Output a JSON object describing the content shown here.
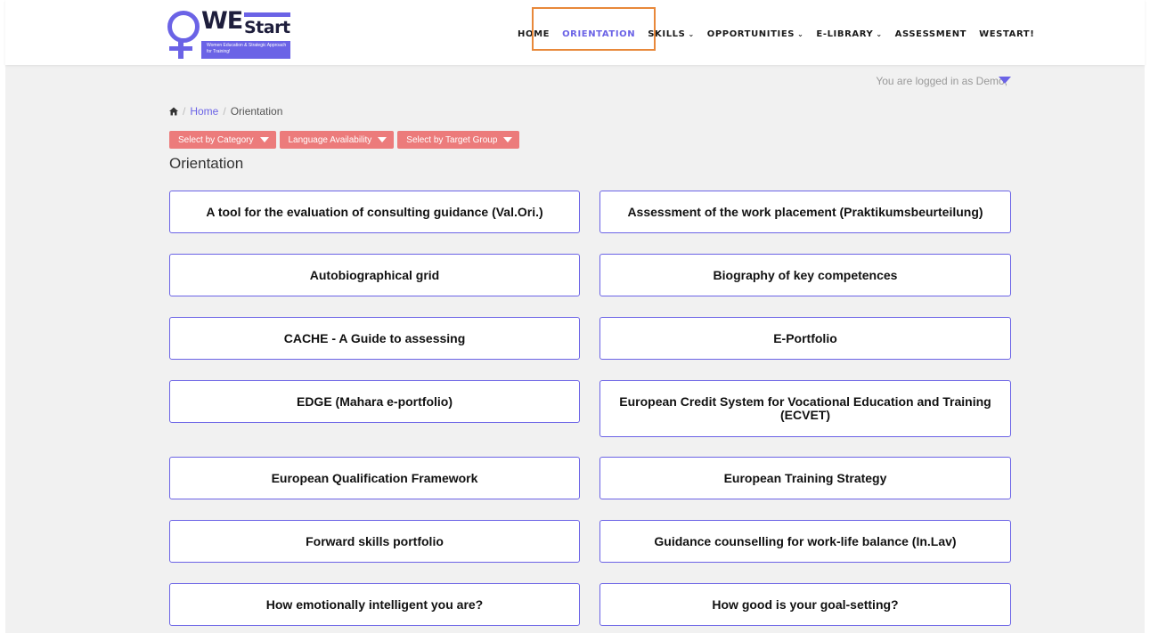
{
  "logo": {
    "word1": "WE",
    "word2": "Start",
    "tagline": "Women Education & Strategic Approach for Training!"
  },
  "nav": {
    "items": [
      {
        "label": "HOME"
      },
      {
        "label": "ORIENTATION"
      },
      {
        "label": "SKILLS"
      },
      {
        "label": "OPPORTUNITIES"
      },
      {
        "label": "E-LIBRARY"
      },
      {
        "label": "ASSESSMENT"
      },
      {
        "label": "WESTART!"
      }
    ]
  },
  "user": {
    "logged_text": "You are logged in as Demo,"
  },
  "breadcrumb": {
    "home": "Home",
    "current": "Orientation"
  },
  "filters": {
    "category": "Select by Category",
    "language": "Language Availability",
    "target": "Select by Target Group"
  },
  "page": {
    "title": "Orientation"
  },
  "cards": [
    {
      "title": "A tool for the evaluation of consulting guidance (Val.Ori.)"
    },
    {
      "title": "Assessment of the work placement (Praktikumsbeurteilung)"
    },
    {
      "title": "Autobiographical grid"
    },
    {
      "title": "Biography of key competences"
    },
    {
      "title": "CACHE - A Guide to assessing"
    },
    {
      "title": "E-Portfolio"
    },
    {
      "title": "EDGE (Mahara e-portfolio)"
    },
    {
      "title": "European Credit System for Vocational Education and Training (ECVET)"
    },
    {
      "title": "European Qualification Framework"
    },
    {
      "title": "European Training Strategy"
    },
    {
      "title": "Forward skills portfolio"
    },
    {
      "title": "Guidance counselling for work-life balance (In.Lav)"
    },
    {
      "title": "How emotionally intelligent you are?"
    },
    {
      "title": "How good is your goal-setting?"
    }
  ],
  "colors": {
    "accent": "#6b63e6",
    "filter": "#ec7b7b",
    "highlight": "#e8883a"
  }
}
